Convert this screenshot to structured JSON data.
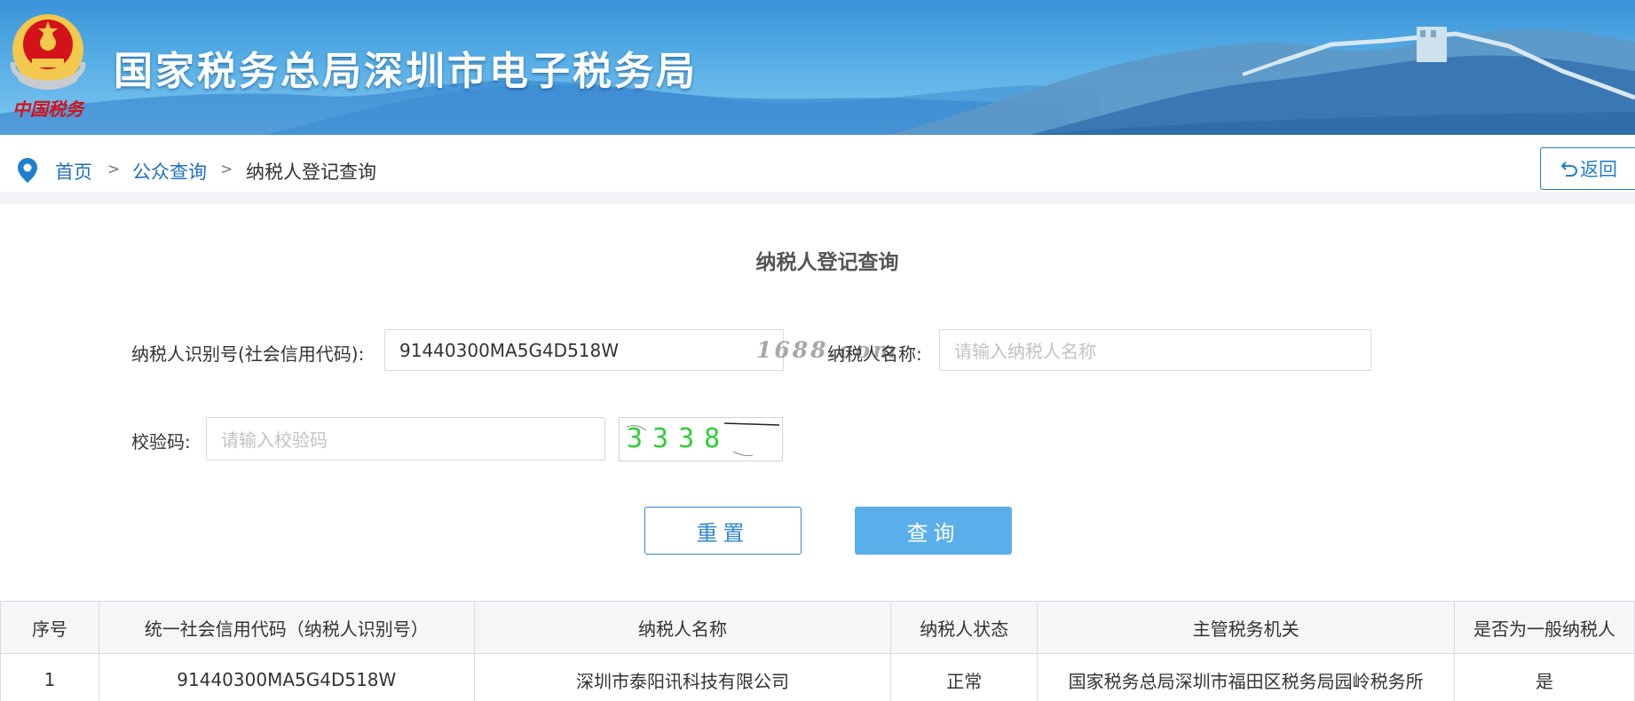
{
  "header": {
    "title": "国家税务总局深圳市电子税务局",
    "emblem_caption": "中国税务",
    "colors": {
      "banner_top": "#3a93d8",
      "banner_bottom": "#7fc6ef",
      "emblem_red": "#d4121a",
      "emblem_gold": "#f2c94c"
    }
  },
  "breadcrumb": {
    "items": [
      {
        "label": "首页"
      },
      {
        "label": "公众查询"
      },
      {
        "label": "纳税人登记查询"
      }
    ],
    "separator": ">",
    "back_label": "返回"
  },
  "form": {
    "title": "纳税人登记查询",
    "taxpayer_id_label": "纳税人识别号(社会信用代码):",
    "taxpayer_id_value": "91440300MA5G4D518W",
    "taxpayer_name_label": "纳税人名称:",
    "taxpayer_name_placeholder": "请输入纳税人名称",
    "captcha_label": "校验码:",
    "captcha_placeholder": "请输入校验码",
    "captcha_image_text": "3338",
    "watermark": "1688.com",
    "reset_label": "重置",
    "query_label": "查询",
    "colors": {
      "accent": "#2f86d0",
      "query_bg": "#5aaeea"
    }
  },
  "table": {
    "columns": [
      "序号",
      "统一社会信用代码（纳税人识别号）",
      "纳税人名称",
      "纳税人状态",
      "主管税务机关",
      "是否为一般纳税人"
    ],
    "rows": [
      [
        "1",
        "91440300MA5G4D518W",
        "深圳市泰阳讯科技有限公司",
        "正常",
        "国家税务总局深圳市福田区税务局园岭税务所",
        "是"
      ]
    ]
  }
}
